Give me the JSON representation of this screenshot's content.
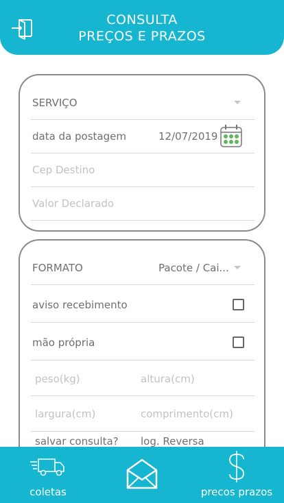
{
  "header": {
    "title_line1": "CONSULTA",
    "title_line2": "PREÇOS E PRAZOS",
    "exit_icon": "exit-door-icon"
  },
  "form1": {
    "servico": {
      "label": "SERVIÇO",
      "selected": ""
    },
    "data_postagem": {
      "label": "data da postagem",
      "value": "12/07/2019"
    },
    "cep_destino": {
      "placeholder": "Cep Destino"
    },
    "valor_declarado": {
      "placeholder": "Valor Declarado"
    }
  },
  "form2": {
    "formato": {
      "label": "FORMATO",
      "selected": "Pacote / Cai..."
    },
    "aviso_recebimento": {
      "label": "aviso recebimento",
      "checked": false
    },
    "mao_propria": {
      "label": "mão própria",
      "checked": false
    },
    "peso": {
      "placeholder": "peso(kg)"
    },
    "altura": {
      "placeholder": "altura(cm)"
    },
    "largura": {
      "placeholder": "largura(cm)"
    },
    "comprimento": {
      "placeholder": "comprimento(cm)"
    },
    "salvar_consulta": {
      "label": "salvar consulta?"
    },
    "log_reversa": {
      "label": "log. Reversa"
    }
  },
  "bottom_nav": {
    "coletas": {
      "label": "coletas",
      "icon": "truck-icon"
    },
    "center": {
      "icon": "envelope-icon"
    },
    "precos_prazos": {
      "label": "precos prazos",
      "icon": "dollar-icon"
    }
  },
  "colors": {
    "accent": "#16b5d0",
    "calendar_green": "#5cb85c",
    "border": "#8a8a8a"
  }
}
